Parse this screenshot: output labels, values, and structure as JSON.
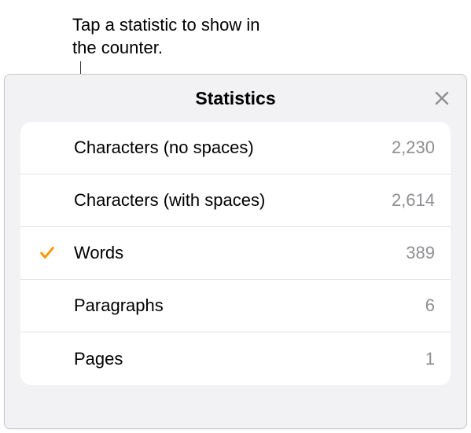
{
  "callout": {
    "text": "Tap a statistic to show in the counter."
  },
  "panel": {
    "title": "Statistics",
    "close_label": "Close",
    "stats": [
      {
        "label": "Characters (no spaces)",
        "value": "2,230",
        "selected": false
      },
      {
        "label": "Characters (with spaces)",
        "value": "2,614",
        "selected": false
      },
      {
        "label": "Words",
        "value": "389",
        "selected": true
      },
      {
        "label": "Paragraphs",
        "value": "6",
        "selected": false
      },
      {
        "label": "Pages",
        "value": "1",
        "selected": false
      }
    ]
  }
}
